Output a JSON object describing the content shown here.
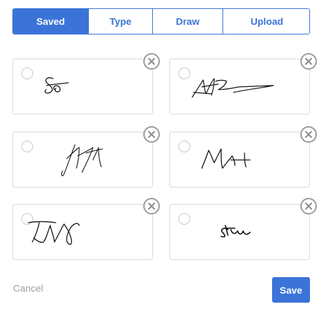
{
  "tabs": [
    {
      "label": "Saved",
      "active": true
    },
    {
      "label": "Type",
      "active": false
    },
    {
      "label": "Draw",
      "active": false
    },
    {
      "label": "Upload",
      "active": false
    }
  ],
  "signatures": [
    {
      "id": 1,
      "selected": false
    },
    {
      "id": 2,
      "selected": false
    },
    {
      "id": 3,
      "selected": false
    },
    {
      "id": 4,
      "selected": false
    },
    {
      "id": 5,
      "selected": false
    },
    {
      "id": 6,
      "selected": false
    }
  ],
  "actions": {
    "cancel_label": "Cancel",
    "save_label": "Save"
  },
  "colors": {
    "accent": "#3b73d8",
    "muted_text": "#9aa0a6",
    "border": "#d9d9d9"
  },
  "icons": {
    "delete": "close-icon",
    "select": "radio-icon"
  }
}
